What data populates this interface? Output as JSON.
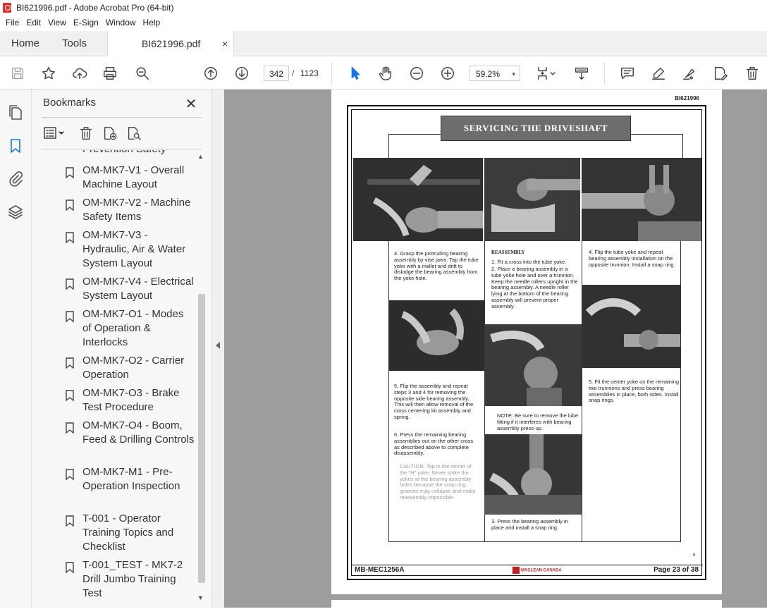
{
  "window": {
    "title": "BI621996.pdf - Adobe Acrobat Pro (64-bit)"
  },
  "menu": [
    "File",
    "Edit",
    "View",
    "E-Sign",
    "Window",
    "Help"
  ],
  "tabs": {
    "home": "Home",
    "tools": "Tools",
    "document": "BI621996.pdf",
    "close": "×"
  },
  "toolbar": {
    "current_page": "342",
    "separator": "/",
    "total_pages": "1123",
    "zoom": "59.2%",
    "zoom_caret": "▾"
  },
  "bookmarks": {
    "title": "Bookmarks",
    "close": "✕",
    "partial_item": "Prevention Safety",
    "items": [
      {
        "label": "OM-MK7-V1 - Overall Machine Layout"
      },
      {
        "label": "OM-MK7-V2 - Machine Safety Items"
      },
      {
        "label": "OM-MK7-V3 - Hydraulic, Air & Water System Layout"
      },
      {
        "label": "OM-MK7-V4 - Electrical System Layout"
      },
      {
        "label": "OM-MK7-O1 - Modes of Operation & Interlocks"
      },
      {
        "label": "OM-MK7-O2 - Carrier Operation"
      },
      {
        "label": "OM-MK7-O3 - Brake Test Procedure"
      },
      {
        "label": "OM-MK7-O4 - Boom, Feed & Drilling Controls"
      },
      {
        "label": "OM-MK7-M1 - Pre-Operation Inspection"
      },
      {
        "label": "T-001 - Operator Training Topics and Checklist"
      },
      {
        "label": "T-001_TEST - MK7-2 Drill Jumbo Training Test"
      }
    ]
  },
  "document": {
    "doc_id": "BI621996",
    "banner": "SERVICING THE DRIVESHAFT",
    "captions": {
      "step4_left": "4. Grasp the protruding bearing assembly by vise jaws. Tap the tube yoke with a mallet and drift to dislodge the bearing assembly from the yoke hole.",
      "reassembly_title": "REASSEMBLY",
      "reassembly_1": "1. Fit a cross into the tube yoke.",
      "reassembly_2": "2. Place a bearing assembly in a tube yoke hole and over a trunnion. Keep the needle rollers upright in the bearing assembly. A needle roller lying at the bottom of the bearing assembly will prevent proper assembly.",
      "step4_right": "4. Flip the tube yoke and repeat bearing assembly installation on the opposite trunnion. Install a snap ring.",
      "step5_left": "5. Flip the assembly and repeat steps 3 and 4 for removing the opposite side bearing assembly. This will then allow removal of the cross centering kit assembly and spring.",
      "step6_left": "6. Press the remaining bearing assemblies out on the other cross as described above to complete disassembly.",
      "caution": "CAUTION: Tap in the center of the \"H\" yoke. Never strike the yokes at the bearing assembly holes because the snap ring grooves may collapse and make reassembly impossible.",
      "note": "NOTE: Be sure to remove the lube fitting if it interferes with bearing assembly press-up.",
      "step5_right": "5. Fit the center yoke on the remaining two trunnions and press bearing assemblies in place, both sides. Install snap rings.",
      "step3": "3. Press the bearing assembly in place and install a snap ring.",
      "page_mark": "5"
    },
    "footer": {
      "left": "MB-MEC1256A",
      "logo": "MACLEAN CANADA",
      "right": "Page 23 of 38"
    }
  }
}
